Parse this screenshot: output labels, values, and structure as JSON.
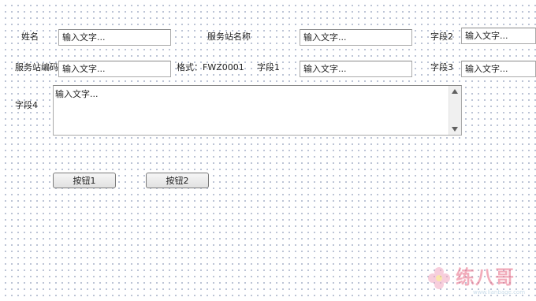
{
  "form": {
    "row1": {
      "name_label": "姓名",
      "name_placeholder": "输入文字...",
      "station_name_label": "服务站名称",
      "station_name_placeholder": "输入文字...",
      "field2_label": "字段2",
      "field2_placeholder": "输入文字..."
    },
    "row2": {
      "station_code_label": "服务站编码",
      "station_code_placeholder": "输入文字...",
      "format_hint": "格式：FWZ0001",
      "field1_label": "字段1",
      "field1_placeholder": "输入文字...",
      "field3_label": "字段3",
      "field3_placeholder": "输入文字..."
    },
    "row3": {
      "field4_label": "字段4",
      "field4_placeholder": "输入文字..."
    },
    "buttons": {
      "button1_label": "按钮1",
      "button2_label": "按钮2"
    }
  },
  "watermark": {
    "text": "练八哥",
    "url": "www.lianbage.com",
    "colors": {
      "text": "#e96a85",
      "flower": "#f2a7c0",
      "url": "#9cc0d8"
    }
  }
}
